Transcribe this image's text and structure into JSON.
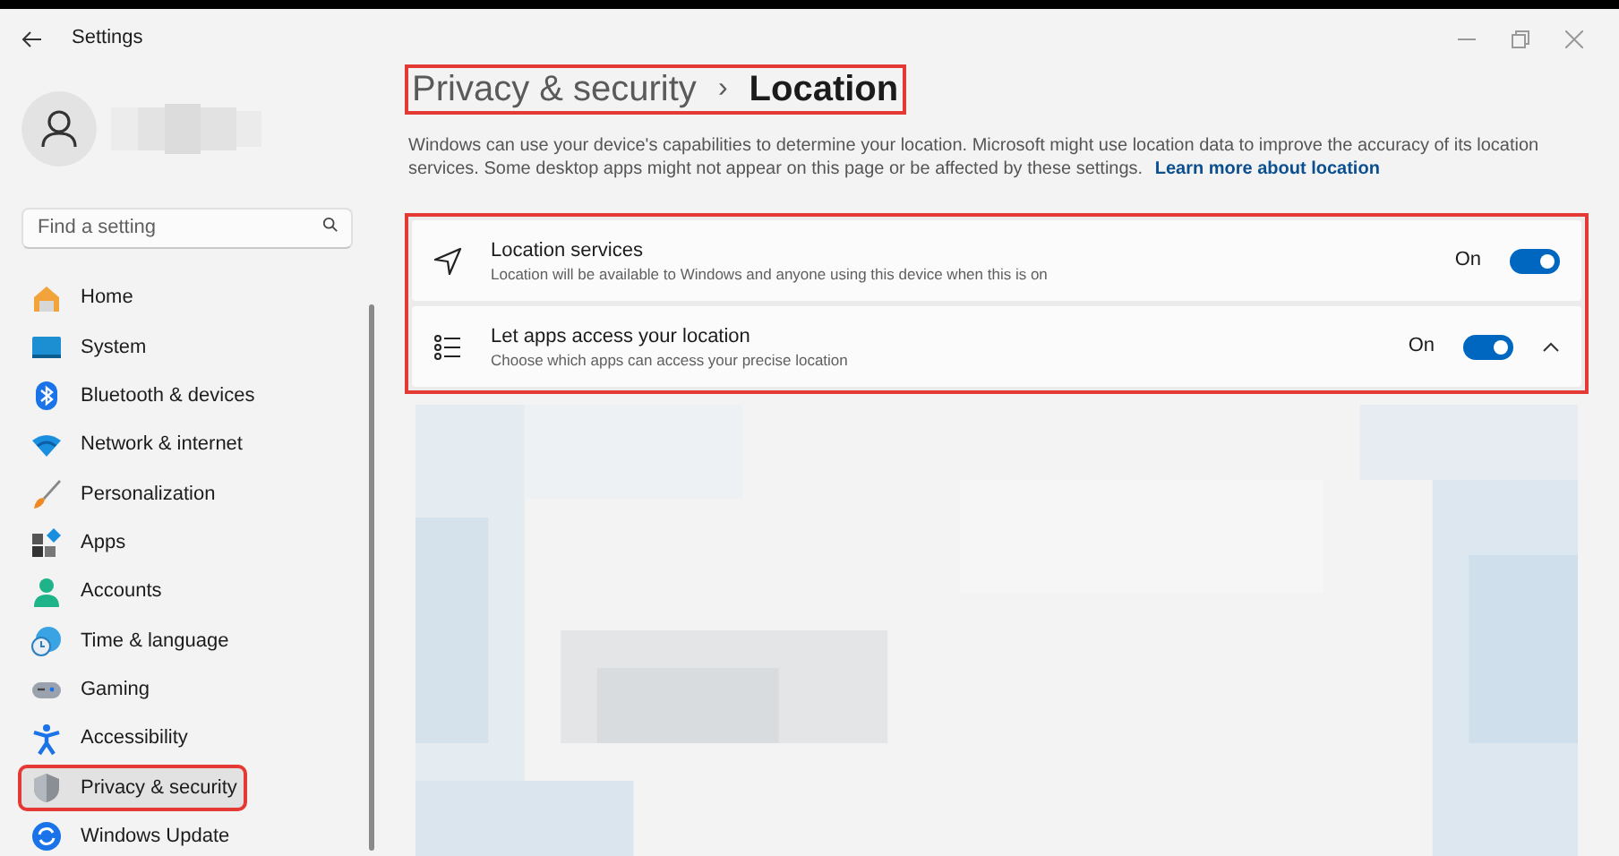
{
  "window": {
    "title": "Settings"
  },
  "search": {
    "placeholder": "Find a setting"
  },
  "nav": [
    {
      "label": "Home",
      "selected": false,
      "highlighted": false
    },
    {
      "label": "System",
      "selected": false,
      "highlighted": false
    },
    {
      "label": "Bluetooth & devices",
      "selected": false,
      "highlighted": false
    },
    {
      "label": "Network & internet",
      "selected": false,
      "highlighted": false
    },
    {
      "label": "Personalization",
      "selected": false,
      "highlighted": false
    },
    {
      "label": "Apps",
      "selected": false,
      "highlighted": false
    },
    {
      "label": "Accounts",
      "selected": false,
      "highlighted": false
    },
    {
      "label": "Time & language",
      "selected": false,
      "highlighted": false
    },
    {
      "label": "Gaming",
      "selected": false,
      "highlighted": false
    },
    {
      "label": "Accessibility",
      "selected": false,
      "highlighted": false
    },
    {
      "label": "Privacy & security",
      "selected": true,
      "highlighted": true
    },
    {
      "label": "Windows Update",
      "selected": false,
      "highlighted": false
    }
  ],
  "breadcrumb": {
    "parent": "Privacy & security",
    "separator": "›",
    "current": "Location",
    "highlighted": true
  },
  "description": {
    "text": "Windows can use your device's capabilities to determine your location. Microsoft might use location data to improve the accuracy of its location services. Some desktop apps might not appear on this page or be affected by these settings.",
    "link": "Learn more about location"
  },
  "settings_group": {
    "highlighted": true,
    "items": [
      {
        "title": "Location services",
        "subtitle": "Location will be available to Windows and anyone using this device when this is on",
        "state_label": "On",
        "on": true
      },
      {
        "title": "Let apps access your location",
        "subtitle": "Choose which apps can access your precise location",
        "state_label": "On",
        "on": true,
        "expanded": true
      }
    ]
  }
}
